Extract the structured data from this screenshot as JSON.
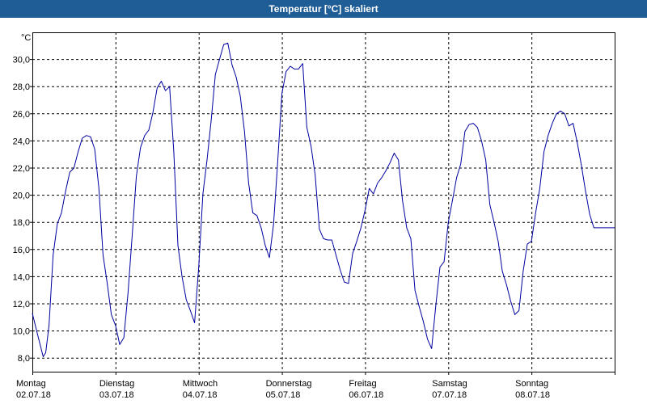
{
  "window": {
    "title": "Temperatur [°C] skaliert"
  },
  "chart_data": {
    "type": "line",
    "title": "Temperatur [°C] skaliert",
    "ylabel": "°C",
    "ylim": [
      7.0,
      32.0
    ],
    "yticks": [
      8.0,
      10.0,
      12.0,
      14.0,
      16.0,
      18.0,
      20.0,
      22.0,
      24.0,
      26.0,
      28.0,
      30.0
    ],
    "ytick_labels": [
      "8,0",
      "10,0",
      "12,0",
      "14,0",
      "16,0",
      "18,0",
      "20,0",
      "22,0",
      "24,0",
      "26,0",
      "28,0",
      "30,0"
    ],
    "xlim": [
      0,
      7
    ],
    "x_ticks": [
      {
        "day": "Montag",
        "date": "02.07.18"
      },
      {
        "day": "Dienstag",
        "date": "03.07.18"
      },
      {
        "day": "Mittwoch",
        "date": "04.07.18"
      },
      {
        "day": "Donnerstag",
        "date": "05.07.18"
      },
      {
        "day": "Freitag",
        "date": "06.07.18"
      },
      {
        "day": "Samstag",
        "date": "07.07.18"
      },
      {
        "day": "Sonntag",
        "date": "08.07.18"
      }
    ],
    "grid": true,
    "line_color": "#0000a0",
    "series": [
      {
        "x": [
          0.0,
          0.06,
          0.13,
          0.16,
          0.2,
          0.25,
          0.3,
          0.35,
          0.4,
          0.45,
          0.5,
          0.55,
          0.6,
          0.65,
          0.7,
          0.75,
          0.8,
          0.85,
          0.9,
          0.95,
          1.0,
          1.05,
          1.1,
          1.15,
          1.2,
          1.25,
          1.3,
          1.35,
          1.4,
          1.45,
          1.5,
          1.55,
          1.6,
          1.65,
          1.7,
          1.75,
          1.8,
          1.85,
          1.9,
          1.95,
          2.0,
          2.05,
          2.1,
          2.15,
          2.2,
          2.25,
          2.3,
          2.35,
          2.4,
          2.45,
          2.5,
          2.55,
          2.6,
          2.65,
          2.7,
          2.75,
          2.8,
          2.85,
          2.9,
          2.95,
          3.0,
          3.05,
          3.1,
          3.15,
          3.2,
          3.25,
          3.3,
          3.35,
          3.4,
          3.45,
          3.5,
          3.55,
          3.6,
          3.65,
          3.7,
          3.75,
          3.8,
          3.85,
          3.9,
          3.95,
          4.0,
          4.05,
          4.1,
          4.15,
          4.2,
          4.25,
          4.3,
          4.35,
          4.4,
          4.45,
          4.5,
          4.55,
          4.6,
          4.65,
          4.7,
          4.75,
          4.8,
          4.85,
          4.9,
          4.95,
          5.0,
          5.05,
          5.1,
          5.15,
          5.2,
          5.25,
          5.3,
          5.35,
          5.4,
          5.45,
          5.5,
          5.55,
          5.6,
          5.65,
          5.7,
          5.75,
          5.8,
          5.85,
          5.9,
          5.95,
          6.0,
          6.05,
          6.1,
          6.15,
          6.2,
          6.25,
          6.3,
          6.35,
          6.4,
          6.45,
          6.5,
          6.55,
          6.6,
          6.65,
          6.7,
          6.75,
          6.8,
          6.85,
          6.9,
          6.95,
          7.0
        ],
        "y": [
          11.3,
          9.8,
          8.1,
          8.4,
          10.4,
          15.6,
          17.9,
          18.7,
          20.3,
          21.7,
          22.0,
          23.2,
          24.2,
          24.4,
          24.3,
          23.4,
          20.5,
          15.6,
          13.5,
          11.2,
          10.4,
          9.0,
          9.5,
          12.8,
          17.0,
          21.4,
          23.5,
          24.4,
          24.8,
          26.1,
          27.9,
          28.4,
          27.7,
          28.0,
          23.2,
          16.3,
          14.0,
          12.3,
          11.5,
          10.6,
          14.7,
          20.1,
          22.6,
          25.5,
          28.9,
          30.0,
          31.1,
          31.2,
          29.6,
          28.7,
          27.3,
          24.7,
          20.9,
          18.7,
          18.5,
          17.6,
          16.3,
          15.4,
          17.9,
          22.5,
          27.5,
          29.1,
          29.5,
          29.3,
          29.3,
          29.7,
          25.0,
          23.6,
          21.5,
          17.5,
          16.8,
          16.7,
          16.7,
          15.6,
          14.5,
          13.6,
          13.5,
          15.7,
          16.6,
          17.6,
          18.9,
          20.5,
          20.1,
          20.9,
          21.3,
          21.8,
          22.4,
          23.1,
          22.6,
          19.6,
          17.6,
          16.8,
          13.0,
          11.8,
          10.7,
          9.4,
          8.7,
          11.9,
          14.7,
          15.1,
          18.0,
          19.6,
          21.3,
          22.3,
          24.7,
          25.2,
          25.3,
          25.0,
          24.0,
          22.6,
          19.3,
          18.0,
          16.6,
          14.4,
          13.4,
          12.2,
          11.2,
          11.5,
          14.4,
          16.4,
          16.6,
          18.7,
          20.5,
          23.2,
          24.4,
          25.3,
          26.0,
          26.2,
          26.0,
          25.1,
          25.3,
          23.9,
          22.2,
          20.3,
          18.6,
          17.6,
          17.6,
          17.6,
          17.6,
          17.6,
          17.6
        ]
      }
    ]
  }
}
